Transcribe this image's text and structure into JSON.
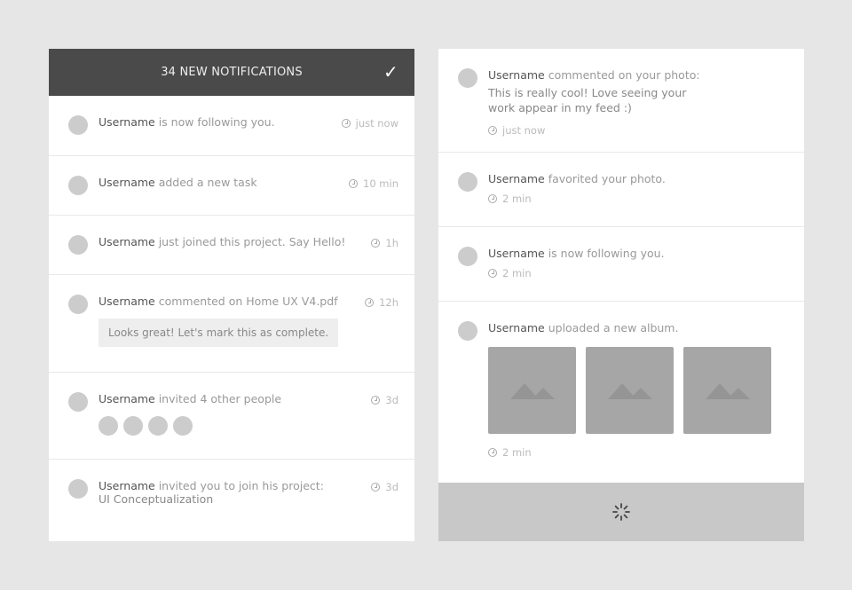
{
  "left": {
    "title": "34 NEW NOTIFICATIONS",
    "items": [
      {
        "user": "Username",
        "text": " is now following you.",
        "time": "just now"
      },
      {
        "user": "Username",
        "text": " added a new task",
        "time": "10 min"
      },
      {
        "user": "Username",
        "text": " just joined this project. Say Hello!",
        "time": "1h"
      },
      {
        "user": "Username",
        "text": " commented on Home UX V4.pdf",
        "time": "12h",
        "quote": "Looks great! Let's mark this as complete."
      },
      {
        "user": "Username",
        "text": " invited 4 other people",
        "time": "3d"
      },
      {
        "user": "Username",
        "text": " invited you to join his project:",
        "text2": "UI Conceptualization",
        "time": "3d"
      }
    ]
  },
  "right": {
    "items": [
      {
        "user": "Username",
        "text": " commented on your photo:",
        "body": "This is really cool! Love seeing your work appear in my feed :)",
        "time": "just now"
      },
      {
        "user": "Username",
        "text": " favorited your photo.",
        "time": "2 min"
      },
      {
        "user": "Username",
        "text": " is now following you.",
        "time": "2 min"
      },
      {
        "user": "Username",
        "text": " uploaded a new album.",
        "time": "2 min"
      }
    ]
  }
}
